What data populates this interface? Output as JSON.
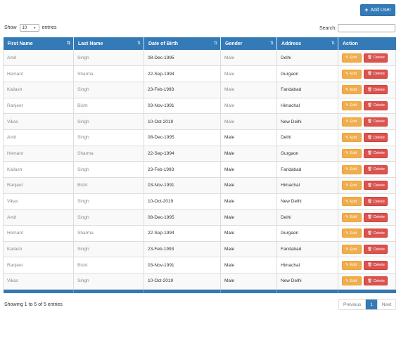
{
  "toolbar": {
    "add_user_label": "Add User"
  },
  "controls": {
    "show_label": "Show",
    "entries_value": "10",
    "entries_label": "entries",
    "search_label": "Search:",
    "search_value": ""
  },
  "table": {
    "headers": [
      "First Name",
      "Last Name",
      "Date of Birth",
      "Gender",
      "Address",
      "Action"
    ],
    "edit_label": "Edit",
    "delete_label": "Delete",
    "rows": [
      [
        "Amit",
        "Singh",
        "08-Dec-1995",
        "Male",
        "Delhi"
      ],
      [
        "Hemant",
        "Sharma",
        "22-Sep-1994",
        "Male",
        "Gurgaon"
      ],
      [
        "Kailash",
        "Singh",
        "23-Feb-1993",
        "Male",
        "Faridabad"
      ],
      [
        "Ranjeet",
        "Bisht",
        "03-Nov-1991",
        "Male",
        "Himachal"
      ],
      [
        "Vikas",
        "Singh",
        "10-Oct-2019",
        "Male",
        "New Delhi"
      ],
      [
        "Amit",
        "Singh",
        "08-Dec-1995",
        "Male",
        "Delhi"
      ],
      [
        "Hemant",
        "Sharma",
        "22-Sep-1994",
        "Male",
        "Gurgaon"
      ],
      [
        "Kailash",
        "Singh",
        "23-Feb-1993",
        "Male",
        "Faridabad"
      ],
      [
        "Ranjeet",
        "Bisht",
        "03-Nov-1991",
        "Male",
        "Himachal"
      ],
      [
        "Vikas",
        "Singh",
        "10-Oct-2019",
        "Male",
        "New Delhi"
      ],
      [
        "Amit",
        "Singh",
        "08-Dec-1995",
        "Male",
        "Delhi"
      ],
      [
        "Hemant",
        "Sharma",
        "22-Sep-1994",
        "Male",
        "Gurgaon"
      ],
      [
        "Kailash",
        "Singh",
        "23-Feb-1993",
        "Male",
        "Faridabad"
      ],
      [
        "Ranjeet",
        "Bisht",
        "03-Nov-1991",
        "Male",
        "Himachal"
      ],
      [
        "Vikas",
        "Singh",
        "10-Oct-2019",
        "Male",
        "New Delhi"
      ]
    ]
  },
  "footer": {
    "info": "Showing 1 to 5 of 5 entries",
    "previous_label": "Previous",
    "current_page": "1",
    "next_label": "Next"
  },
  "colors": {
    "primary": "#337ab7",
    "warning": "#f0ad4e",
    "danger": "#d9534f"
  }
}
